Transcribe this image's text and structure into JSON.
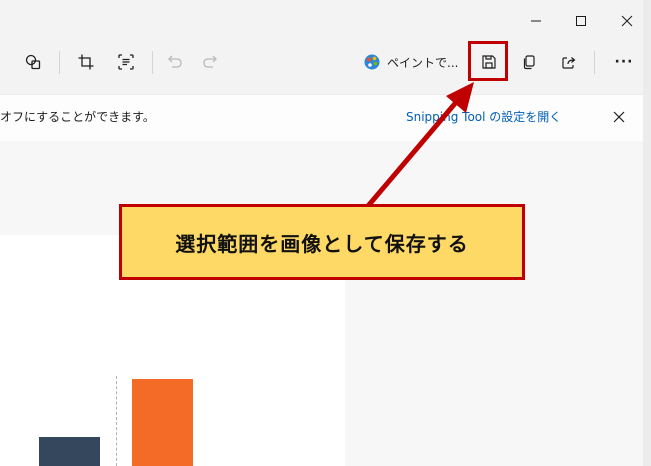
{
  "titlebar": {
    "minimize_icon": "minimize-icon",
    "maximize_icon": "maximize-icon",
    "close_icon": "close-icon"
  },
  "toolbar": {
    "paint_label": "ペイントで...",
    "more_label": "···"
  },
  "infobar": {
    "message": "オフにすることができます。",
    "link": "Snipping Tool の設定を開く"
  },
  "annotation": {
    "callout": "選択範囲を画像として保存する",
    "highlight_color": "#c00000",
    "callout_bg": "#ffd966"
  },
  "canvas": {
    "bar_colors": [
      "#35475c",
      "#f36b26"
    ]
  }
}
